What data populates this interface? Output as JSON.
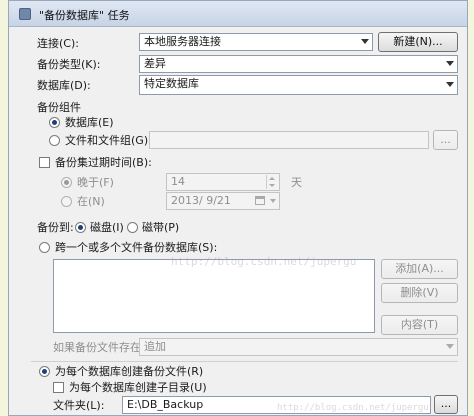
{
  "window": {
    "title": "\"备份数据库\" 任务"
  },
  "connection": {
    "label": "连接(C):",
    "value": "本地服务器连接",
    "new_button": "新建(N)..."
  },
  "backup_type": {
    "label": "备份类型(K):",
    "value": "差异"
  },
  "database": {
    "label": "数据库(D):",
    "value": "特定数据库"
  },
  "components": {
    "group_label": "备份组件",
    "database_radio": "数据库(E)",
    "files_radio": "文件和文件组(G):",
    "browse_button": "..."
  },
  "expiration": {
    "check_label": "备份集过期时间(B):",
    "after_radio": "晚于(F)",
    "after_value": "14",
    "after_unit": "天",
    "on_radio": "在(N)",
    "on_value": "2013/  9/21"
  },
  "backup_to": {
    "label": "备份到:",
    "disk": "磁盘(I)",
    "tape": "磁带(P)"
  },
  "stripe": {
    "radio_label": "跨一个或多个文件备份数据库(S):",
    "add_button": "添加(A)...",
    "remove_button": "删除(V)",
    "contents_button": "内容(T)",
    "if_exists_label": "如果备份文件存在(X):",
    "if_exists_value": "追加"
  },
  "per_db": {
    "radio_label": "为每个数据库创建备份文件(R)",
    "subdir_label": "为每个数据库创建子目录(U)",
    "folder_label": "文件夹(L):",
    "folder_value": "E:\\DB_Backup",
    "browse_button": "..."
  },
  "watermarks": {
    "center": "http://blog.csdn.net/jupergu",
    "bottom": "http://blog.csdn.net/jupergu"
  }
}
